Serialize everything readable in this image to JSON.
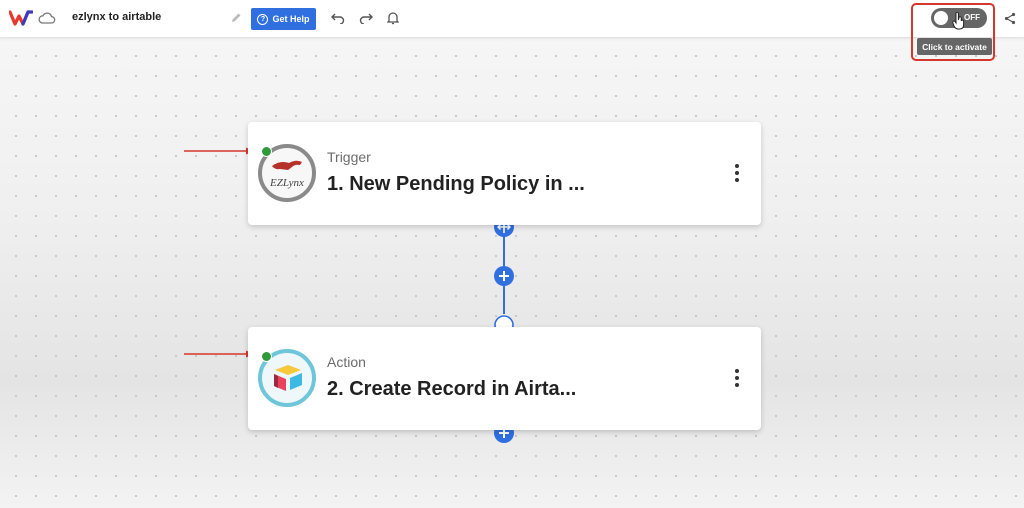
{
  "header": {
    "workflow_title": "ezlynx to airtable",
    "help_label": "Get Help",
    "help_icon_glyph": "?",
    "toggle_state": "OFF",
    "tooltip": "Click to activate"
  },
  "icons": [
    "logo-icon",
    "cloud-icon",
    "pencil-icon",
    "undo-icon",
    "redo-icon",
    "bell-icon",
    "share-icon",
    "kebab-menu-icon",
    "plus-icon",
    "resize-icon"
  ],
  "colors": {
    "accent": "#2f6fe0",
    "status_active": "#2e9a3a",
    "annotation": "#d5372c",
    "toggle_off": "#666666"
  },
  "steps": [
    {
      "type": "Trigger",
      "name": "1. New Pending Policy in ...",
      "app": "EZLynx",
      "app_logo_text": "EZLynx"
    },
    {
      "type": "Action",
      "name": "2. Create Record in Airta...",
      "app": "Airtable"
    }
  ]
}
